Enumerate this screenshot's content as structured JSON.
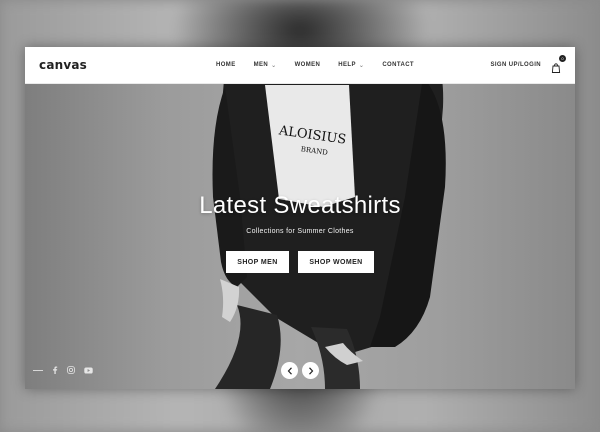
{
  "brand": {
    "logo": "canvas"
  },
  "nav": {
    "items": [
      {
        "label": "HOME",
        "dropdown": false
      },
      {
        "label": "MEN",
        "dropdown": true
      },
      {
        "label": "WOMEN",
        "dropdown": false
      },
      {
        "label": "HELP",
        "dropdown": true
      },
      {
        "label": "CONTACT",
        "dropdown": false
      }
    ],
    "signup_label": "SIGN UP/LOGIN",
    "cart_count": "0"
  },
  "hero": {
    "title": "Latest Sweatshirts",
    "subtitle": "Collections for Summer Clothes",
    "buttons": {
      "men": "SHOP MEN",
      "women": "SHOP WOMEN"
    },
    "shirt_print": {
      "line1": "ALOISIUS",
      "line2": "BRAND"
    }
  },
  "social": {
    "icons": [
      "facebook-icon",
      "instagram-icon",
      "youtube-icon"
    ]
  },
  "colors": {
    "nav_bg": "#ffffff",
    "button_bg": "#ffffff",
    "text_dark": "#222222"
  }
}
